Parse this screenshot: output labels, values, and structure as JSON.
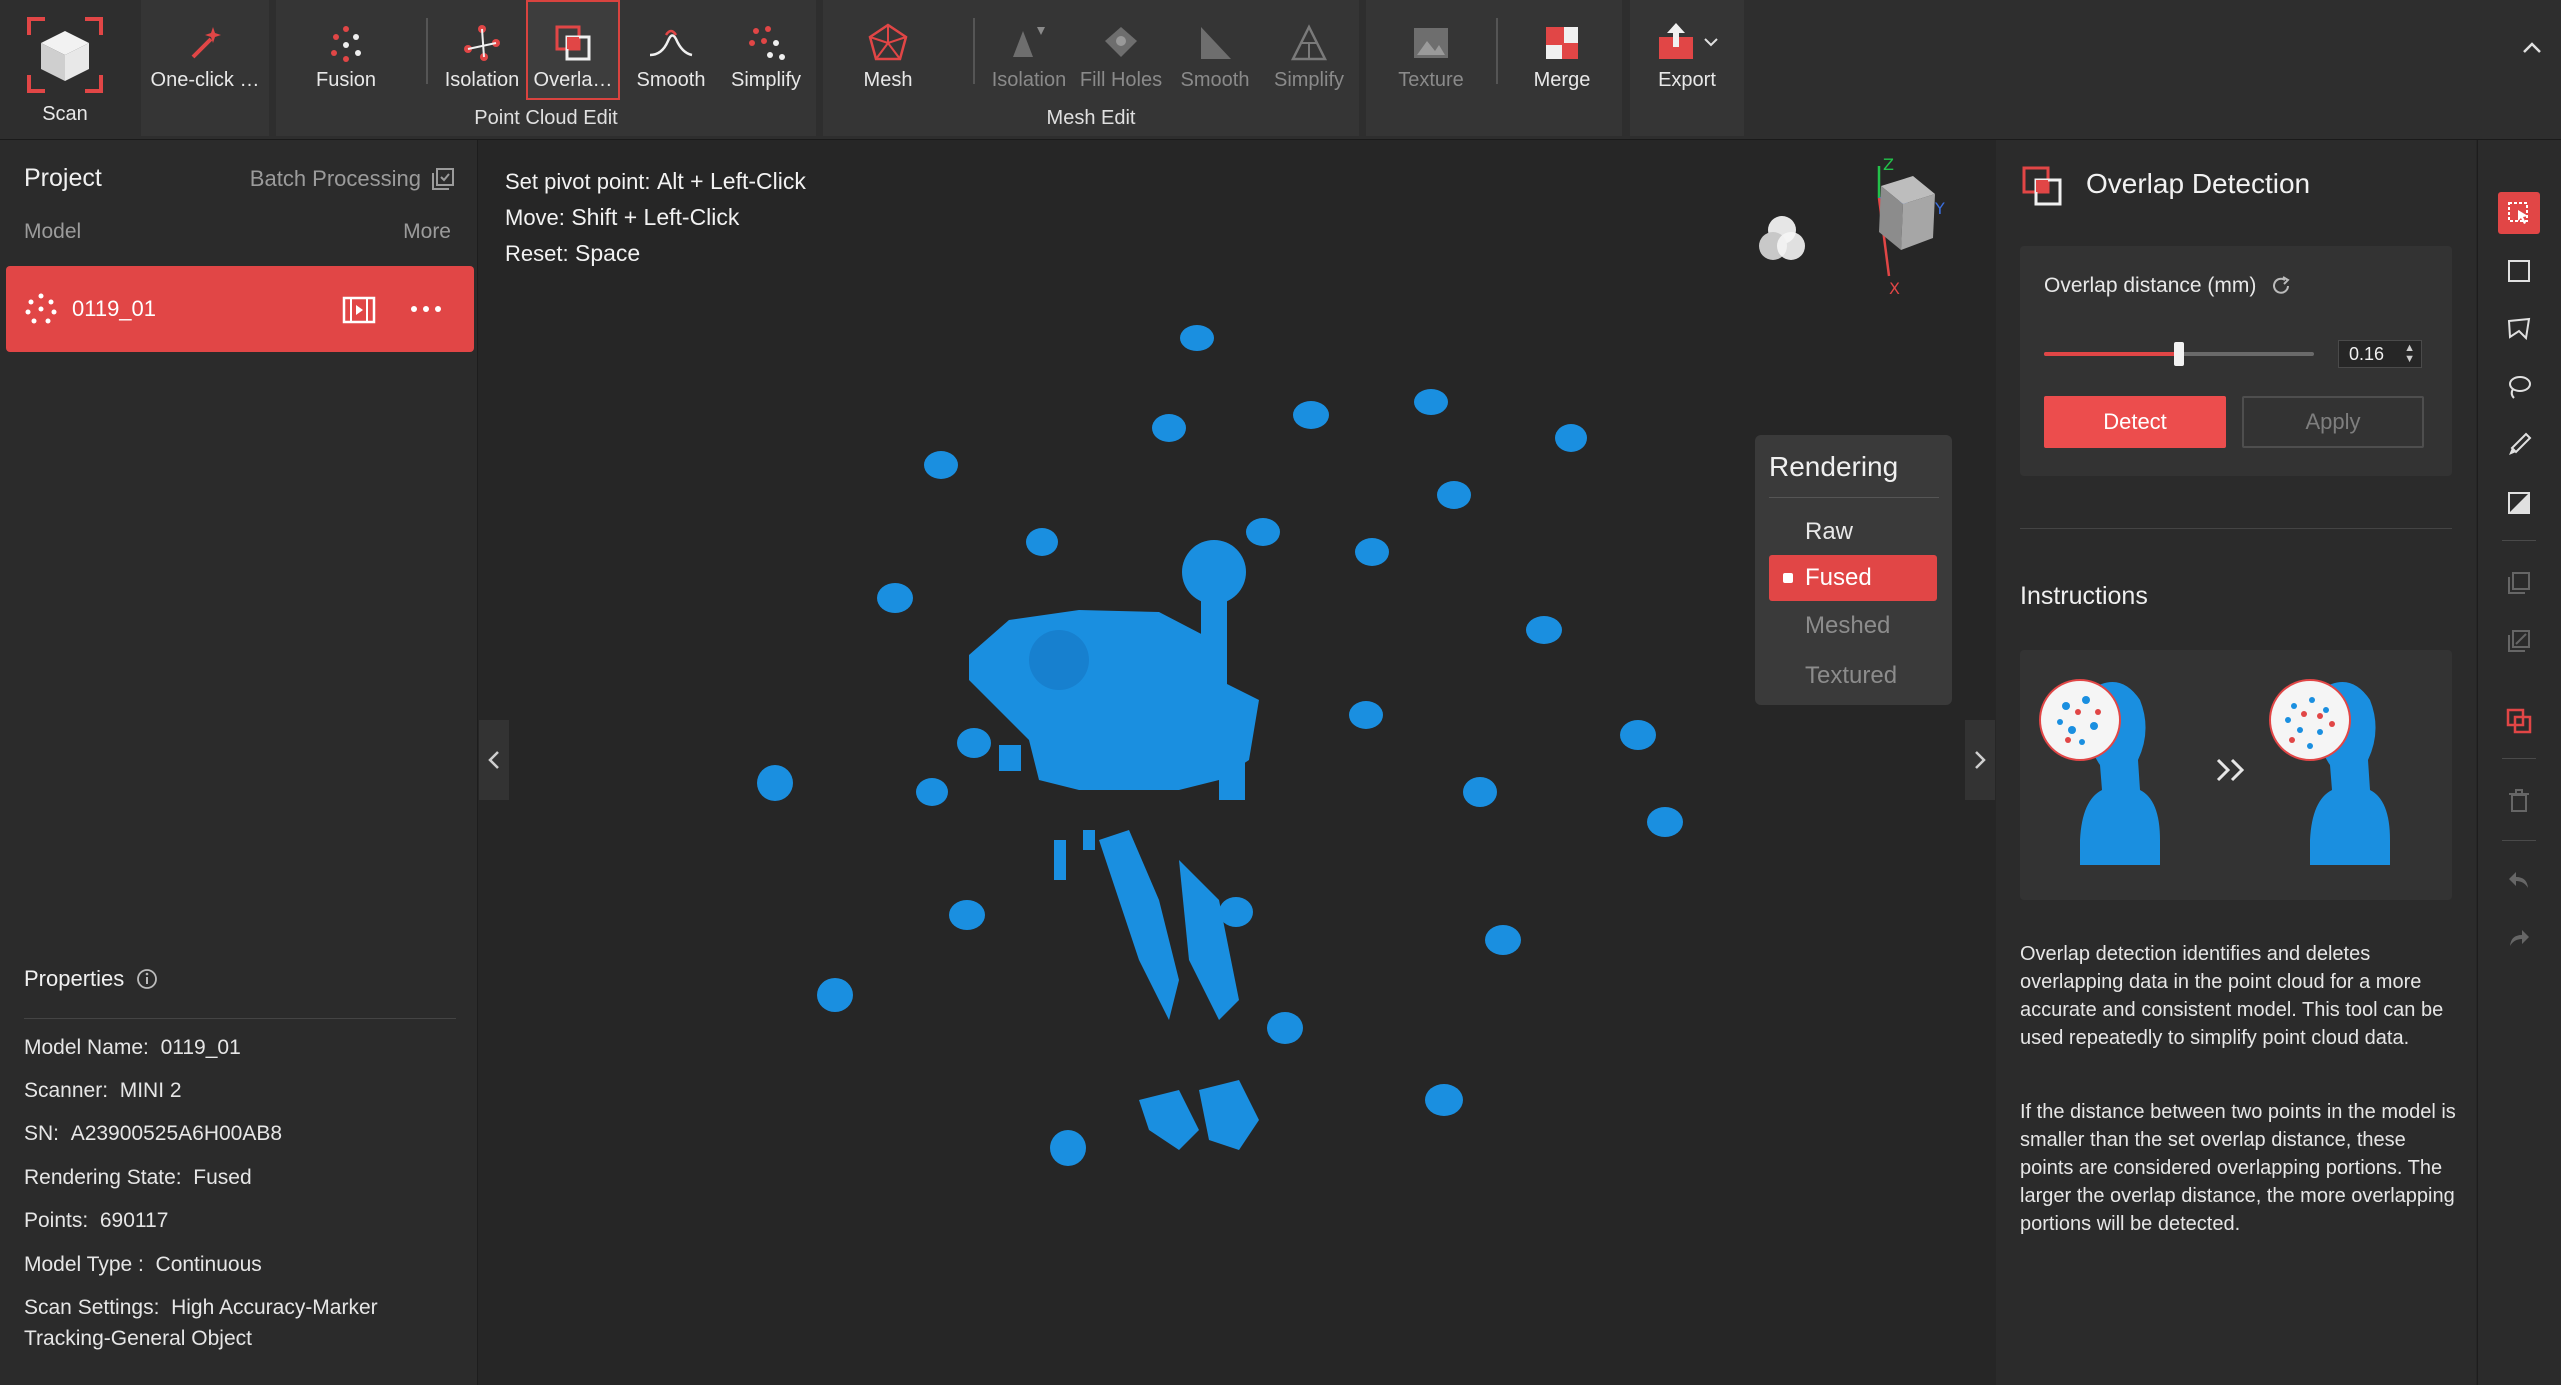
{
  "toolbar": {
    "scan": "Scan",
    "one_click": "One-click …",
    "fusion": "Fusion",
    "isolation": "Isolation",
    "overlap": "Overla…",
    "smooth": "Smooth",
    "simplify": "Simplify",
    "point_cloud_edit": "Point Cloud Edit",
    "mesh": "Mesh",
    "mesh_isolation": "Isolation",
    "fill_holes": "Fill Holes",
    "mesh_smooth": "Smooth",
    "mesh_simplify": "Simplify",
    "mesh_edit": "Mesh Edit",
    "texture": "Texture",
    "merge": "Merge",
    "export": "Export"
  },
  "left": {
    "project": "Project",
    "batch": "Batch Processing",
    "model": "Model",
    "more": "More",
    "model_name": "0119_01",
    "properties": "Properties",
    "props": [
      {
        "k": "Model Name:",
        "v": "0119_01"
      },
      {
        "k": "Scanner:",
        "v": "MINI 2"
      },
      {
        "k": "SN:",
        "v": "A23900525A6H00AB8"
      },
      {
        "k": "Rendering State:",
        "v": "Fused"
      },
      {
        "k": "Points:",
        "v": "690117"
      },
      {
        "k": "Model Type :",
        "v": "Continuous"
      },
      {
        "k": "Scan Settings:",
        "v": "High Accuracy-Marker Tracking-General Object"
      }
    ]
  },
  "viewport": {
    "hint1_k": "Set pivot point:",
    "hint1_v": "Alt + Left-Click",
    "hint2_k": "Move:",
    "hint2_v": "Shift + Left-Click",
    "hint3_k": "Reset:",
    "hint3_v": "Space",
    "axis_z": "Z",
    "axis_y": "Y",
    "axis_x": "X",
    "rendering": "Rendering",
    "raw": "Raw",
    "fused": "Fused",
    "meshed": "Meshed",
    "textured": "Textured"
  },
  "right": {
    "title": "Overlap Detection",
    "overlap_label": "Overlap distance (mm)",
    "overlap_value": "0.16",
    "slider_fraction": 0.5,
    "detect": "Detect",
    "apply": "Apply",
    "instructions": "Instructions",
    "para1": "Overlap detection identifies and deletes overlapping data in the point cloud for a more accurate and consistent model. This tool can be used repeatedly to simplify point cloud data.",
    "para2": "If the distance between two points in the model is smaller than the set overlap distance, these points are considered overlapping portions. The larger the overlap distance, the more overlapping portions will be detected."
  },
  "colors": {
    "accent": "#e14646",
    "point_cloud": "#1a8fe0"
  }
}
